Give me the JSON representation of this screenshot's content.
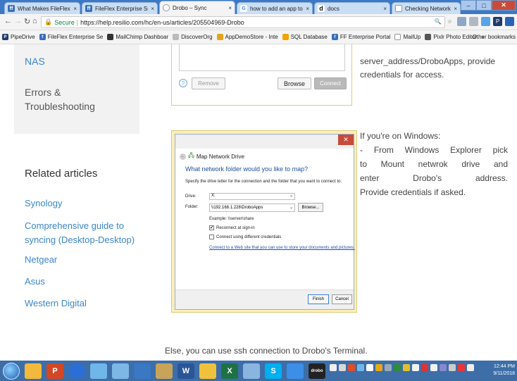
{
  "browser": {
    "tabs": [
      {
        "label": "What Makes FileFlex D",
        "active": false
      },
      {
        "label": "FileFlex Enterprise Se",
        "active": false
      },
      {
        "label": "Drobo – Sync",
        "active": true
      },
      {
        "label": "how to add an app to",
        "active": false
      },
      {
        "label": "docs",
        "active": false
      },
      {
        "label": "Checking Network Inf",
        "active": false
      }
    ],
    "close_glyph": "×",
    "address": {
      "secure_label": "Secure",
      "separator": "|",
      "url": "https://help.resilio.com/hc/en-us/articles/205504969-Drobo"
    },
    "bookmarks": [
      "PipeDrive",
      "FileFlex Enterprise Se",
      "MailChimp Dashboar",
      "DiscoverOrg",
      "AppDemoStore - Inte",
      "SQL Database",
      "FF Enterprise Portal",
      "MailUp",
      "Pixlr Photo Editor"
    ],
    "bookmarks_more": "»",
    "other_bookmarks": "Other bookmarks"
  },
  "sidebar": {
    "nas_label": "NAS",
    "errors_label": "Errors & Troubleshooting"
  },
  "related": {
    "heading": "Related articles",
    "articles": [
      "Synology",
      "Comprehensive guide to syncing (Desktop-Desktop)",
      "Netgear",
      "Asus",
      "Western Digital"
    ]
  },
  "top_screenshot": {
    "remove_label": "Remove",
    "browse_label": "Browse",
    "connect_label": "Connect"
  },
  "body_text": {
    "top_right": "server_address/DroboApps, provide credentials for access.",
    "windows_lines": [
      "If you're on Windows:",
      "- From Windows Explorer pick",
      "to Mount netwrok drive and",
      "enter     Drobo's     address.",
      "Provide credentials if asked."
    ],
    "ssh_line": "Else, you can use ssh connection to Drobo's Terminal."
  },
  "map_drive_dialog": {
    "title": "Map Network Drive",
    "question": "What network folder would you like to map?",
    "instructions": "Specify the drive letter for the connection and the folder that you want to connect to:",
    "drive_label": "Drive:",
    "drive_value": "X:",
    "folder_label": "Folder:",
    "folder_value": "\\\\192.168.1.228\\DroboApps",
    "browse_label": "Browse...",
    "example": "Example: \\\\server\\share",
    "reconnect_label": "Reconnect at sign-in",
    "reconnect_checked": true,
    "different_creds_label": "Connect using different credentials",
    "different_creds_checked": false,
    "link_text": "Connect to a Web site that you can use to store your documents and pictures.",
    "finish_label": "Finish",
    "cancel_label": "Cancel"
  },
  "taskbar": {
    "time": "12:44 PM",
    "date": "9/11/2018"
  }
}
